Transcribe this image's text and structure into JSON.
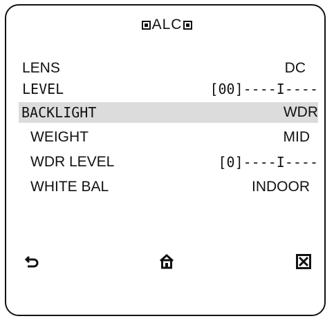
{
  "menu": {
    "title": "ALC",
    "items": [
      {
        "label": "LENS",
        "value": "DC"
      },
      {
        "label": "LEVEL",
        "value": "[00]----I----"
      },
      {
        "label": "BACKLIGHT",
        "value": "WDR"
      },
      {
        "label": "WEIGHT",
        "value": "MID"
      },
      {
        "label": "WDR LEVEL",
        "value": "[0]----I----"
      },
      {
        "label": "WHITE BAL",
        "value": "INDOOR"
      }
    ]
  },
  "footer": {
    "back_icon": "back-arrow-icon",
    "home_icon": "home-icon",
    "close_icon": "close-box-icon"
  }
}
